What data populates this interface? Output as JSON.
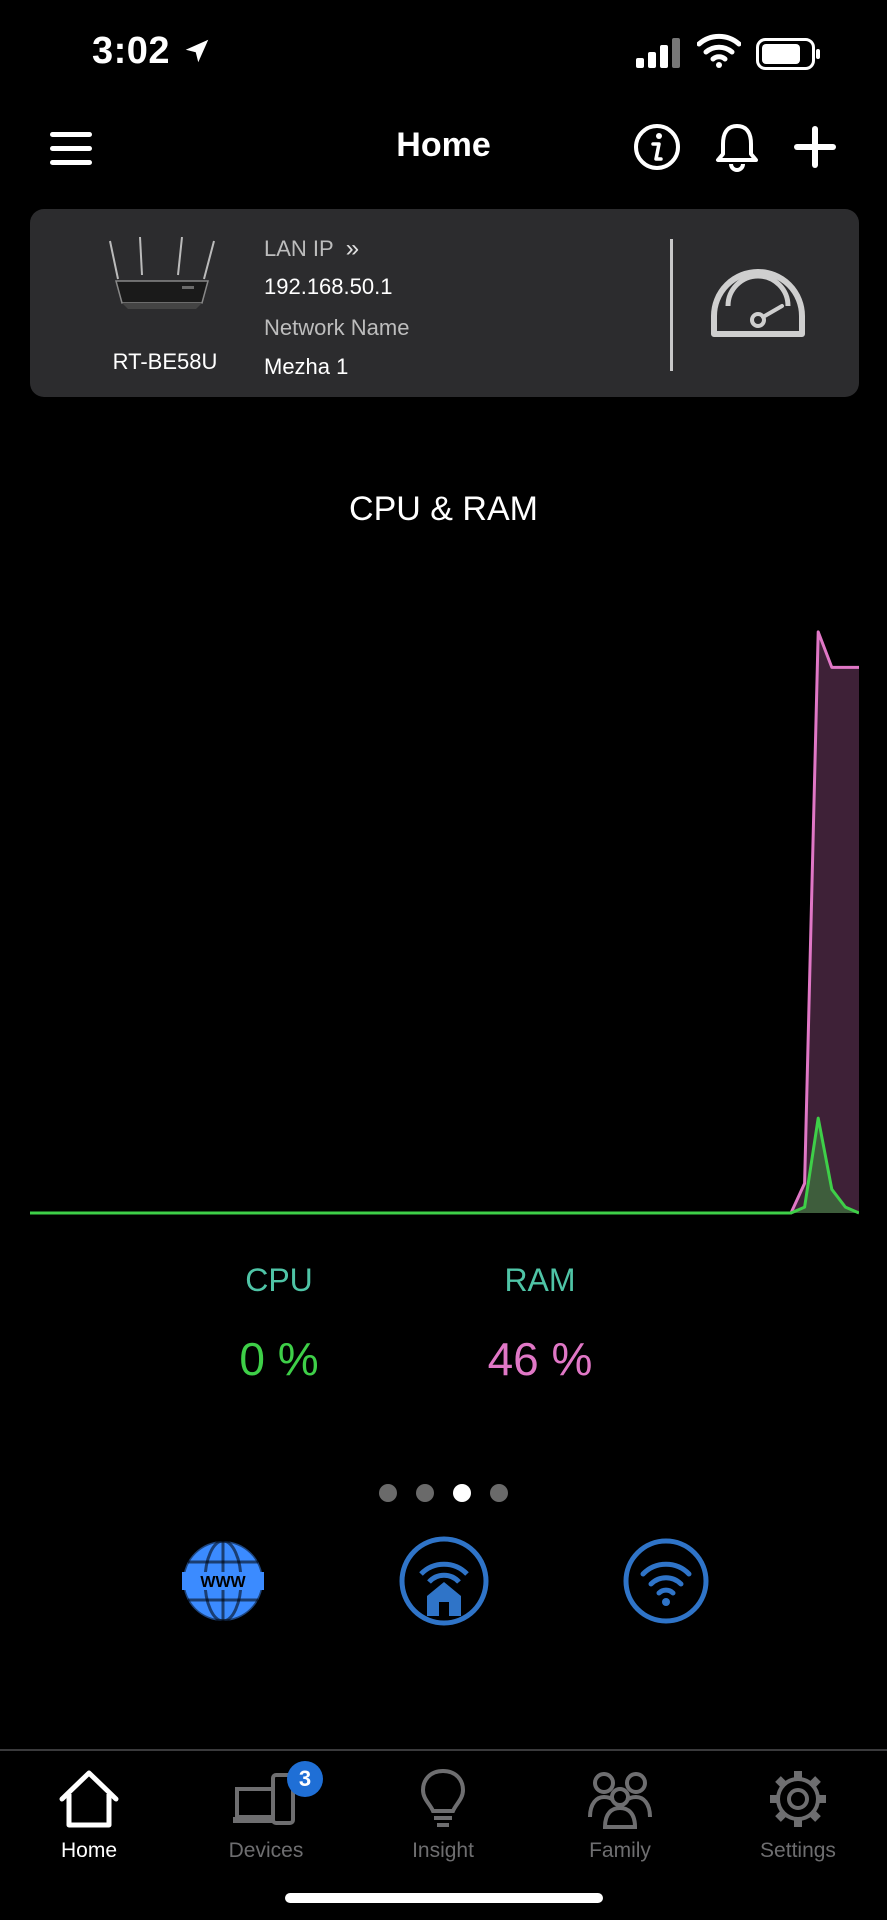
{
  "status_bar": {
    "time": "3:02"
  },
  "nav": {
    "title": "Home"
  },
  "router": {
    "model": "RT-BE58U",
    "lan_ip_label": "LAN IP",
    "lan_ip": "192.168.50.1",
    "network_name_label": "Network Name",
    "network_name": "Mezha 1"
  },
  "chart_title": "CPU & RAM",
  "chart_data": {
    "type": "area",
    "title": "CPU & RAM",
    "xlabel": "",
    "ylabel": "",
    "ylim": [
      0,
      100
    ],
    "grid": false,
    "series": [
      {
        "name": "CPU",
        "color": "#3ecf48",
        "values": [
          0,
          0,
          0,
          0,
          0,
          0,
          0,
          0,
          0,
          0,
          0,
          0,
          0,
          0,
          0,
          0,
          0,
          0,
          0,
          0,
          0,
          0,
          0,
          0,
          0,
          0,
          0,
          0,
          0,
          0,
          0,
          0,
          0,
          0,
          0,
          0,
          0,
          0,
          0,
          0,
          0,
          0,
          0,
          0,
          0,
          0,
          0,
          0,
          0,
          0,
          0,
          0,
          0,
          0,
          0,
          0,
          0,
          1,
          16,
          4,
          1,
          0
        ]
      },
      {
        "name": "RAM",
        "color": "#e077c6",
        "values": [
          0,
          0,
          0,
          0,
          0,
          0,
          0,
          0,
          0,
          0,
          0,
          0,
          0,
          0,
          0,
          0,
          0,
          0,
          0,
          0,
          0,
          0,
          0,
          0,
          0,
          0,
          0,
          0,
          0,
          0,
          0,
          0,
          0,
          0,
          0,
          0,
          0,
          0,
          0,
          0,
          0,
          0,
          0,
          0,
          0,
          0,
          0,
          0,
          0,
          0,
          0,
          0,
          0,
          0,
          0,
          0,
          0,
          5,
          98,
          92,
          92,
          92
        ]
      }
    ]
  },
  "stats": {
    "cpu_label": "CPU",
    "cpu_value": "0 %",
    "ram_label": "RAM",
    "ram_value": "46 %"
  },
  "pager": {
    "count": 4,
    "active_index": 2
  },
  "quick_actions": [
    {
      "icon": "www-globe-icon",
      "color": "#3b8bff"
    },
    {
      "icon": "home-wifi-icon",
      "color": "#2f74c8"
    },
    {
      "icon": "wifi-icon",
      "color": "#2f74c8"
    }
  ],
  "tabs": [
    {
      "label": "Home",
      "icon": "home-icon",
      "active": true
    },
    {
      "label": "Devices",
      "icon": "devices-icon",
      "badge": "3"
    },
    {
      "label": "Insight",
      "icon": "lightbulb-icon"
    },
    {
      "label": "Family",
      "icon": "family-icon"
    },
    {
      "label": "Settings",
      "icon": "gear-icon"
    }
  ],
  "colors": {
    "card_bg": "#2c2c2e",
    "cpu": "#3ecf48",
    "ram": "#e077c6",
    "accent_blue": "#1f6fd6"
  }
}
